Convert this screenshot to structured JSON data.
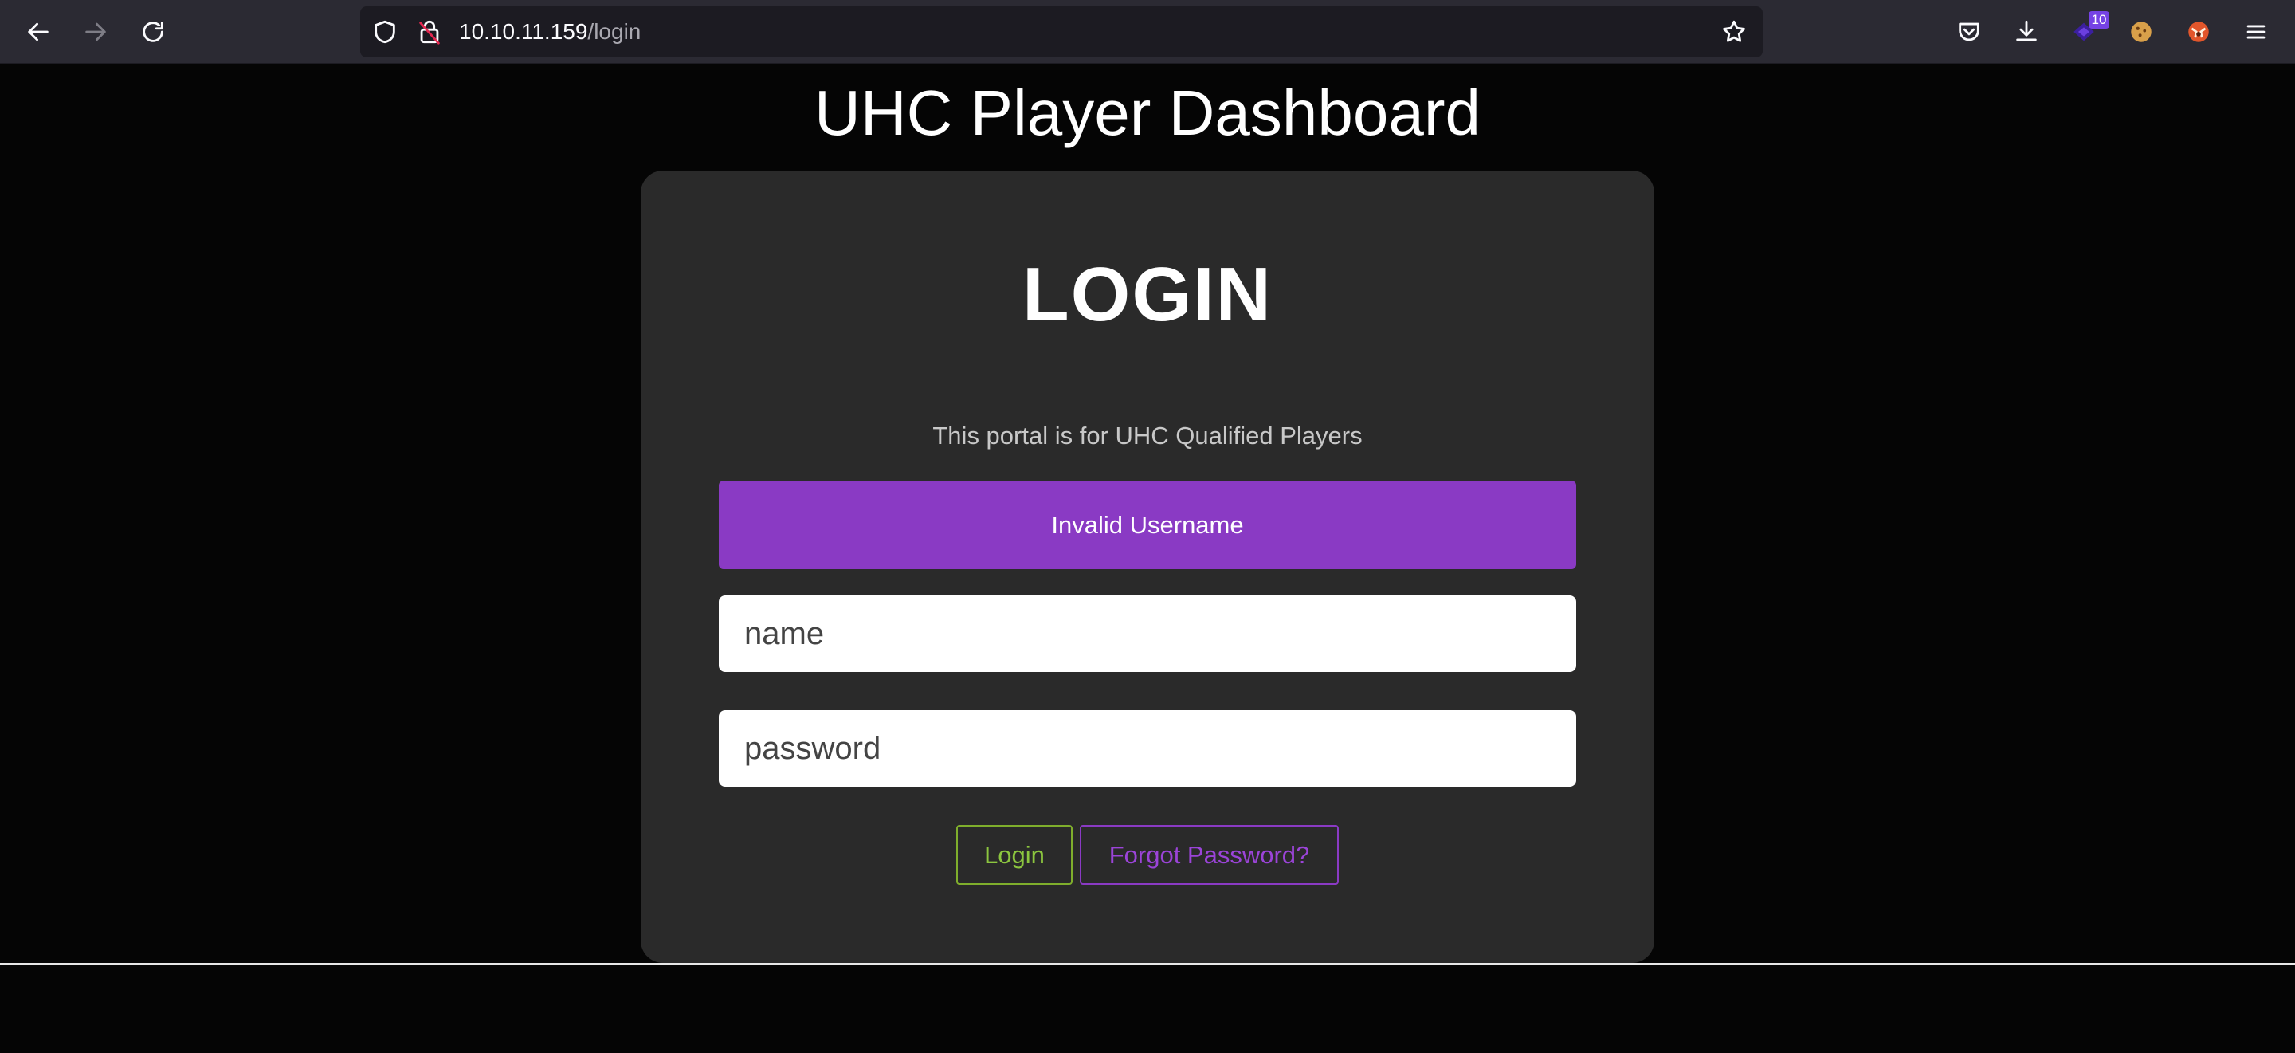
{
  "browser": {
    "url_host": "10.10.11.159",
    "url_path": "/login",
    "extension_badge": "10"
  },
  "page": {
    "title": "UHC Player Dashboard",
    "login_heading": "LOGIN",
    "subtitle": "This portal is for UHC Qualified Players",
    "alert": "Invalid Username",
    "name_placeholder": "name",
    "password_placeholder": "password",
    "login_button": "Login",
    "forgot_button": "Forgot Password?"
  },
  "colors": {
    "alert_bg": "#8a3ac4",
    "login_accent": "#8cc63f",
    "forgot_accent": "#9b44d8",
    "card_bg": "#2a2a2a"
  },
  "icons": [
    "back-icon",
    "forward-icon",
    "reload-icon",
    "shield-icon",
    "insecure-lock-icon",
    "bookmark-star-icon",
    "pocket-icon",
    "downloads-icon",
    "extension-icon",
    "cookie-icon",
    "fox-extension-icon",
    "menu-icon"
  ]
}
